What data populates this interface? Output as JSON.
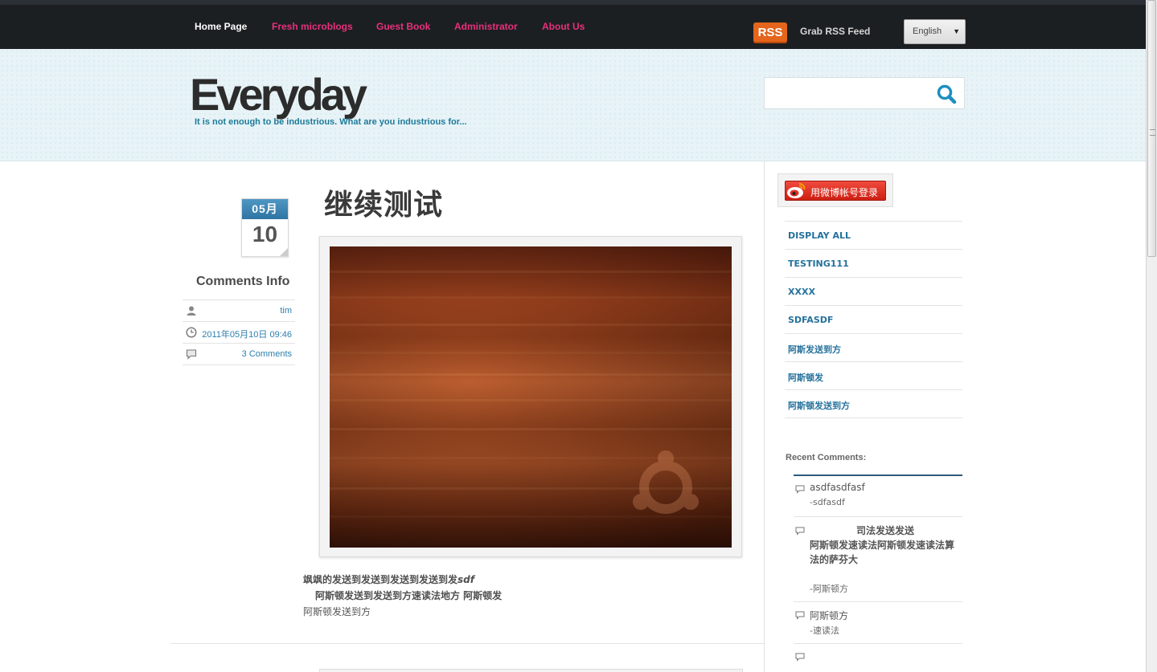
{
  "nav": {
    "items": [
      {
        "label": "Home Page"
      },
      {
        "label": "Fresh microblogs"
      },
      {
        "label": "Guest Book"
      },
      {
        "label": "Administrator"
      },
      {
        "label": "About Us"
      }
    ],
    "rss_badge": "RSS",
    "rss_label": "Grab RSS Feed",
    "language": "English"
  },
  "header": {
    "title": "Everyday",
    "tagline": "It is not enough to be industrious. What are you industrious for...",
    "search_placeholder": ""
  },
  "post": {
    "date_month": "05月",
    "date_day": "10",
    "comments_info_title": "Comments Info",
    "author": "tim",
    "datetime": "2011年05月10日 09:46",
    "comments_link": "3 Comments",
    "title": "继续测试",
    "body_line1": "飒飒的发送到发送到发送到发送到发",
    "body_line1_em": "sdf",
    "body_line2": "阿斯顿发送到发送到方速读法地方 阿斯顿发",
    "body_line3": "阿斯顿发送到方"
  },
  "sidebar": {
    "weibo_login": "用微博帐号登录",
    "categories": [
      {
        "label": "DISPLAY ALL"
      },
      {
        "label": "TESTING111"
      },
      {
        "label": "XXXX"
      },
      {
        "label": "SDFASDF"
      },
      {
        "label": "阿斯发送到方"
      },
      {
        "label": "阿斯顿发"
      },
      {
        "label": "阿斯顿发送到方"
      }
    ],
    "recent_comments_title": "Recent Comments:",
    "recent_comments": [
      {
        "text": "asdfasdfasf",
        "author": "-sdfasdf"
      },
      {
        "text_line1": "司法发送发送",
        "text_line2": "阿斯顿发速读法阿斯顿发速读法算",
        "text_line3": "法的萨芬大",
        "author": "-阿斯顿方"
      },
      {
        "text": "阿斯顿方",
        "author": "-速读法"
      }
    ]
  },
  "colors": {
    "nav_bg": "#1c1f22",
    "nav_link": "#e8307c",
    "accent_blue": "#25719c",
    "header_bg": "#e7f3f7",
    "rss_orange": "#e4651b",
    "weibo_red": "#e02f22"
  }
}
